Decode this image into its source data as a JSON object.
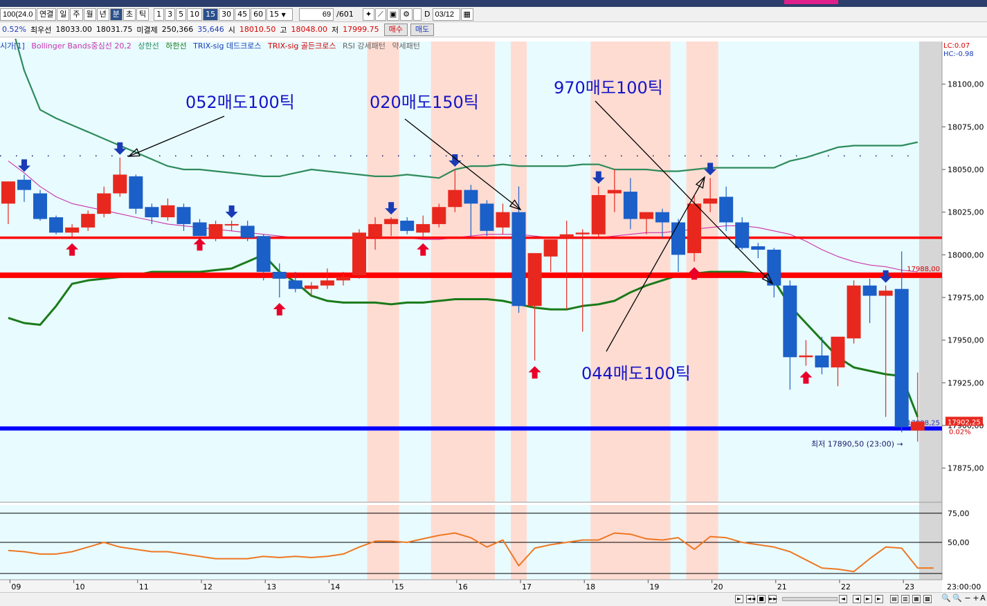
{
  "toolbar": {
    "code_value": "100(24.0",
    "tabs": [
      "연결",
      "일",
      "주",
      "월",
      "년",
      "분",
      "초",
      "틱"
    ],
    "selected_tab": "분",
    "intervals": [
      "1",
      "3",
      "5",
      "10",
      "15",
      "30",
      "45",
      "60"
    ],
    "selected_interval": "15",
    "interval_select": "15",
    "count_value": "69",
    "count_total": "/601",
    "date_checkbox_label": "D",
    "date_value": "03/12"
  },
  "quote": {
    "change_pct": "0.52%",
    "best_bid_label": "최우선",
    "best_bid": "18033.00",
    "best_ask": "18031.75",
    "open_interest_label": "미결제",
    "open_interest": "250,366",
    "open_interest_change": "35,646",
    "open_label": "시",
    "open": "18010.50",
    "high_label": "고",
    "high": "18048.00",
    "low_label": "저",
    "low": "17999.75",
    "buy_button": "매수",
    "sell_button": "매도"
  },
  "legend": {
    "item0": "시가[1]",
    "item1": "Bollinger Bands중심선 20,2",
    "item2": "상한선",
    "item3": "하한선",
    "item4": "TRIX-sig 데드크로스",
    "item5": "TRIX-sig 골든크로스",
    "item6": "RSI 강세패턴",
    "item7": "약세패턴"
  },
  "colors": {
    "background": "#ffffff",
    "plot_bg": "#e8fbff",
    "up_candle": "#e8281e",
    "down_candle": "#1b5fc8",
    "highlight_band": "#ffdcd2",
    "bb_upper_lower": "#2e8b5a",
    "bb_mid": "#cc33aa",
    "lower_line": "#1a7a1a",
    "support_red": "#ff0000",
    "support_blue": "#0000ff",
    "rsi_line": "#ee7722",
    "signal_up": "#e8002a",
    "signal_down": "#1a3bb5"
  },
  "bottombar": {
    "controls": [
      "►",
      "◄◄",
      "■",
      "►►",
      "◄"
    ],
    "zoom_icons": [
      "zoom-out-icon",
      "zoom-in-icon",
      "minus-icon",
      "plus-icon"
    ],
    "font_label": "A"
  },
  "chart_data": [
    {
      "type": "candlestick",
      "title": "",
      "x_tick_labels": [
        "09",
        "10",
        "11",
        "12",
        "13",
        "14",
        "15",
        "16",
        "17",
        "18",
        "19",
        "20",
        "21",
        "22",
        "23"
      ],
      "x_tick_bar_index": [
        0,
        4,
        8,
        12,
        16,
        20,
        24,
        28,
        32,
        36,
        40,
        44,
        48,
        52,
        56
      ],
      "y_ticks": [
        "18100,00",
        "18075,00",
        "18050,00",
        "18025,00",
        "18000,00",
        "17975,00",
        "17950,00",
        "17925,00",
        "17900,00",
        "17875,00"
      ],
      "y_tick_values": [
        18100,
        18075,
        18050,
        18025,
        18000,
        17975,
        17950,
        17925,
        17900,
        17875
      ],
      "ylim": [
        17855,
        18125
      ],
      "corner_labels": [
        "LC:0.07",
        "HC:-0.98"
      ],
      "candles": [
        {
          "o": 18030,
          "h": 18040,
          "l": 18018,
          "c": 18043
        },
        {
          "o": 18044,
          "h": 18047,
          "l": 18031,
          "c": 18038
        },
        {
          "o": 18036,
          "h": 18038,
          "l": 18020,
          "c": 18021
        },
        {
          "o": 18022,
          "h": 18023,
          "l": 18012,
          "c": 18013
        },
        {
          "o": 18013,
          "h": 18018,
          "l": 18010,
          "c": 18016
        },
        {
          "o": 18016,
          "h": 18026,
          "l": 18014,
          "c": 18024
        },
        {
          "o": 18024,
          "h": 18040,
          "l": 18022,
          "c": 18036
        },
        {
          "o": 18036,
          "h": 18057,
          "l": 18034,
          "c": 18047
        },
        {
          "o": 18046,
          "h": 18047,
          "l": 18024,
          "c": 18027
        },
        {
          "o": 18028,
          "h": 18030,
          "l": 18018,
          "c": 18022
        },
        {
          "o": 18022,
          "h": 18033,
          "l": 18020,
          "c": 18029
        },
        {
          "o": 18028,
          "h": 18030,
          "l": 18014,
          "c": 18018
        },
        {
          "o": 18019,
          "h": 18021,
          "l": 18013,
          "c": 18011
        },
        {
          "o": 18010,
          "h": 18020,
          "l": 18008,
          "c": 18018
        },
        {
          "o": 18018,
          "h": 18020,
          "l": 18014,
          "c": 18018
        },
        {
          "o": 18017,
          "h": 18020,
          "l": 18008,
          "c": 18010
        },
        {
          "o": 18011,
          "h": 18012,
          "l": 17985,
          "c": 17990
        },
        {
          "o": 17990,
          "h": 17995,
          "l": 17975,
          "c": 17986
        },
        {
          "o": 17985,
          "h": 17990,
          "l": 17978,
          "c": 17980
        },
        {
          "o": 17980,
          "h": 17984,
          "l": 17976,
          "c": 17982
        },
        {
          "o": 17982,
          "h": 17992,
          "l": 17980,
          "c": 17985
        },
        {
          "o": 17985,
          "h": 17990,
          "l": 17982,
          "c": 17987
        },
        {
          "o": 17988,
          "h": 18015,
          "l": 17986,
          "c": 18013
        },
        {
          "o": 18010,
          "h": 18022,
          "l": 18003,
          "c": 18018
        },
        {
          "o": 18018,
          "h": 18022,
          "l": 18011,
          "c": 18021
        },
        {
          "o": 18020,
          "h": 18022,
          "l": 18012,
          "c": 18014
        },
        {
          "o": 18013,
          "h": 18023,
          "l": 18010,
          "c": 18018
        },
        {
          "o": 18018,
          "h": 18030,
          "l": 18016,
          "c": 18028
        },
        {
          "o": 18028,
          "h": 18050,
          "l": 18025,
          "c": 18038
        },
        {
          "o": 18038,
          "h": 18041,
          "l": 18011,
          "c": 18030
        },
        {
          "o": 18030,
          "h": 18032,
          "l": 18011,
          "c": 18014
        },
        {
          "o": 18016,
          "h": 18030,
          "l": 18012,
          "c": 18025
        },
        {
          "o": 18025,
          "h": 18040,
          "l": 17966,
          "c": 17970
        },
        {
          "o": 17970,
          "h": 18000,
          "l": 17938,
          "c": 18001
        },
        {
          "o": 17999,
          "h": 18005,
          "l": 17990,
          "c": 18009
        },
        {
          "o": 18010,
          "h": 18020,
          "l": 17968,
          "c": 18012
        },
        {
          "o": 18012,
          "h": 18015,
          "l": 17955,
          "c": 18013
        },
        {
          "o": 18012,
          "h": 18040,
          "l": 18010,
          "c": 18035
        },
        {
          "o": 18036,
          "h": 18050,
          "l": 18025,
          "c": 18038
        },
        {
          "o": 18037,
          "h": 18045,
          "l": 18015,
          "c": 18021
        },
        {
          "o": 18021,
          "h": 18025,
          "l": 18012,
          "c": 18025
        },
        {
          "o": 18025,
          "h": 18027,
          "l": 18010,
          "c": 18019
        },
        {
          "o": 18019,
          "h": 18021,
          "l": 17990,
          "c": 18000
        },
        {
          "o": 18001,
          "h": 18035,
          "l": 17996,
          "c": 18030
        },
        {
          "o": 18030,
          "h": 18045,
          "l": 18025,
          "c": 18033
        },
        {
          "o": 18034,
          "h": 18040,
          "l": 18014,
          "c": 18019
        },
        {
          "o": 18019,
          "h": 18022,
          "l": 18003,
          "c": 18004
        },
        {
          "o": 18005,
          "h": 18007,
          "l": 17998,
          "c": 18003
        },
        {
          "o": 18003,
          "h": 18004,
          "l": 17975,
          "c": 17982
        },
        {
          "o": 17982,
          "h": 17985,
          "l": 17921,
          "c": 17940
        },
        {
          "o": 17940,
          "h": 17950,
          "l": 17935,
          "c": 17941
        },
        {
          "o": 17941,
          "h": 17952,
          "l": 17930,
          "c": 17934
        },
        {
          "o": 17934,
          "h": 17950,
          "l": 17923,
          "c": 17952
        },
        {
          "o": 17951,
          "h": 17985,
          "l": 17948,
          "c": 17982
        },
        {
          "o": 17982,
          "h": 17986,
          "l": 17960,
          "c": 17976
        },
        {
          "o": 17976,
          "h": 17982,
          "l": 17905,
          "c": 17979
        },
        {
          "o": 17980,
          "h": 18002,
          "l": 17896,
          "c": 17899
        },
        {
          "o": 17897,
          "h": 17931,
          "l": 17890.5,
          "c": 17902.25
        }
      ],
      "highlight_bands_bar_index": [
        [
          22.5,
          24.5
        ],
        [
          26.5,
          30.5
        ],
        [
          31.5,
          32.5
        ],
        [
          36.5,
          41.5
        ],
        [
          42.5,
          44.5
        ]
      ],
      "bb_upper": [
        18058,
        18058,
        18058,
        18057,
        18057,
        18057,
        18057,
        18057,
        18057,
        18057,
        18057,
        18057,
        18057,
        18057,
        18057,
        18057,
        18057,
        18057,
        18057,
        18057,
        18057,
        18057,
        18057,
        18057,
        18057,
        18057,
        18057,
        18057,
        18057,
        18057,
        18057,
        18057,
        18057,
        18057,
        18057,
        18057,
        18057,
        18057,
        18057,
        18057,
        18057,
        18057,
        18057,
        18057,
        18057,
        18057,
        18057,
        18057,
        18057,
        18057,
        18057,
        18057,
        18057,
        18057,
        18057,
        18057,
        18057,
        18057
      ],
      "bb_mid": [
        18055,
        18048,
        18040,
        18034,
        18030,
        18028,
        18026,
        18024,
        18022,
        18020,
        18018,
        18017,
        18016,
        18015,
        18014,
        18013,
        18012,
        18011,
        18010,
        18010,
        18010,
        18010,
        18010,
        18010,
        18010,
        18010,
        18009,
        18009,
        18010,
        18011,
        18012,
        18012,
        18012,
        18011,
        18010,
        18010,
        18010,
        18010,
        18011,
        18012,
        18013,
        18013,
        18014,
        18015,
        18016,
        18017,
        18017,
        18016,
        18014,
        18012,
        18008,
        18003,
        17999,
        17996,
        17994,
        17993,
        17991,
        17990
      ],
      "bb_outer_green": [
        18142,
        18108,
        18085,
        18080,
        18076,
        18072,
        18068,
        18064,
        18060,
        18056,
        18052,
        18050,
        18050,
        18049,
        18048,
        18047,
        18046,
        18046,
        18048,
        18050,
        18049,
        18048,
        18047,
        18046,
        18046,
        18047,
        18046,
        18045,
        18050,
        18052,
        18052,
        18053,
        18052,
        18052,
        18052,
        18052,
        18053,
        18053,
        18050,
        18050,
        18050,
        18049,
        18049,
        18050,
        18051,
        18051,
        18051,
        18051,
        18051,
        18055,
        18057,
        18060,
        18063,
        18064,
        18064,
        18064,
        18064,
        18066
      ],
      "bb_lower": [
        17963,
        17960,
        17959,
        17970,
        17983,
        17985,
        17986,
        17987,
        17988,
        17990,
        17990,
        17990,
        17990,
        17991,
        17992,
        17996,
        18000,
        17990,
        17984,
        17976,
        17973,
        17972,
        17972,
        17972,
        17971,
        17972,
        17972,
        17973,
        17974,
        17974,
        17974,
        17973,
        17971,
        17969,
        17968,
        17968,
        17970,
        17971,
        17973,
        17978,
        17982,
        17985,
        17988,
        17989,
        17990,
        17990,
        17990,
        17989,
        17985,
        17970,
        17960,
        17950,
        17940,
        17934,
        17932,
        17930,
        17929,
        17905
      ],
      "support_lines": [
        {
          "value": 18010,
          "color": "red",
          "label": ""
        },
        {
          "value": 17988,
          "color": "red",
          "label": "17988,00"
        },
        {
          "value": 17898.25,
          "color": "blue",
          "label": "17898,25"
        }
      ],
      "current_price_label": "17902,25",
      "current_change_label": "0.02%",
      "low_annotation": "최저 17890,50 (23:00)",
      "signals_up_bar_index": [
        4,
        12,
        17,
        26,
        33,
        43,
        50
      ],
      "signals_down_bar_index": [
        1,
        7,
        14,
        24,
        28,
        37,
        44,
        55
      ],
      "annotations": [
        {
          "text": "052매도100틱"
        },
        {
          "text": "020매도150틱"
        },
        {
          "text": "970매도100틱"
        },
        {
          "text": "044매도100틱"
        }
      ]
    },
    {
      "type": "line",
      "title": "",
      "y_ticks": [
        "75,00",
        "50,00"
      ],
      "y_tick_values": [
        75,
        50
      ],
      "ylim": [
        18,
        82
      ],
      "time_label": "23:00:00",
      "rsi": [
        43,
        42,
        40,
        40,
        42,
        46,
        50,
        46,
        44,
        42,
        42,
        40,
        38,
        36,
        36,
        36,
        38,
        37,
        38,
        37,
        38,
        40,
        46,
        51,
        51,
        50,
        53,
        56,
        58,
        54,
        46,
        52,
        30,
        45,
        48,
        50,
        52,
        52,
        58,
        57,
        53,
        52,
        54,
        44,
        55,
        54,
        50,
        48,
        46,
        42,
        35,
        28,
        27,
        25,
        36,
        46,
        45,
        28,
        28
      ]
    }
  ]
}
